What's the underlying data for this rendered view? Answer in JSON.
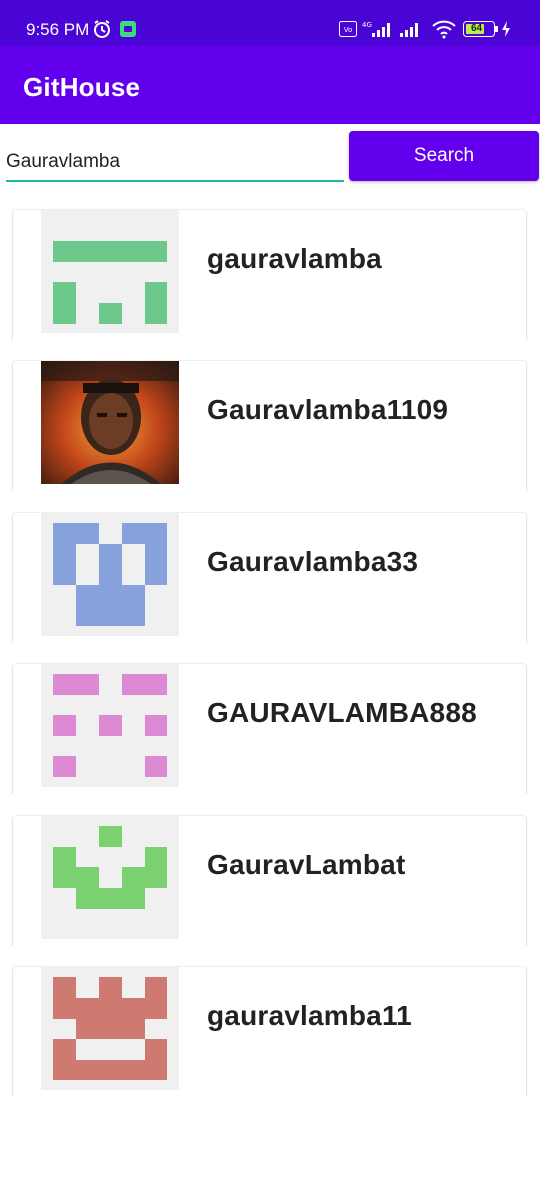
{
  "status_bar": {
    "time": "9:56 PM",
    "battery": "64"
  },
  "app_bar": {
    "title": "GitHouse"
  },
  "search": {
    "value": "Gauravlamba",
    "button_label": "Search"
  },
  "colors": {
    "primary": "#6200ee",
    "status_bar": "#4a05d6",
    "input_underline": "#1fb8a4",
    "avatar_bg": "#f0f0f0"
  },
  "users": [
    {
      "username": "gauravlamba",
      "avatar": "identicon-green",
      "avatar_color": "#6cc98b"
    },
    {
      "username": "Gauravlamba1109",
      "avatar": "photo-warrior"
    },
    {
      "username": "Gauravlamba33",
      "avatar": "identicon-blue",
      "avatar_color": "#86a1dc"
    },
    {
      "username": "GAURAVLAMBA888",
      "avatar": "identicon-pink",
      "avatar_color": "#dc8ad4"
    },
    {
      "username": "GauravLambat",
      "avatar": "identicon-lightgreen",
      "avatar_color": "#7bd170"
    },
    {
      "username": "gauravlamba11",
      "avatar": "identicon-salmon",
      "avatar_color": "#cf7a70"
    }
  ]
}
